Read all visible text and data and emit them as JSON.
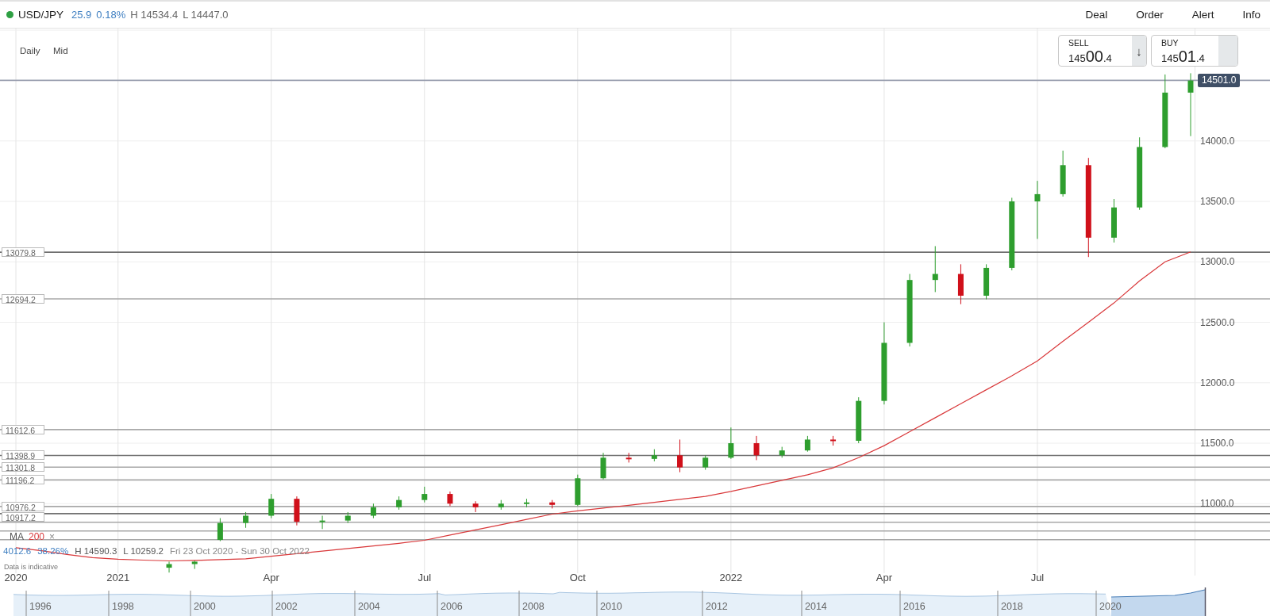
{
  "header": {
    "symbol": "USD/JPY",
    "change": "25.9",
    "change_percent": "0.18%",
    "high": "H 14534.4",
    "low": "L 14447.0",
    "menu": [
      {
        "label": "Deal"
      },
      {
        "label": "Order"
      },
      {
        "label": "Alert"
      },
      {
        "label": "Info"
      }
    ]
  },
  "chart": {
    "interval": "Daily",
    "price_type": "Mid",
    "current_price": "14501.0",
    "sell": {
      "label": "SELL",
      "price_prefix": "145",
      "price_main": "00",
      "price_suffix": ".4",
      "arrow": "↓"
    },
    "buy": {
      "label": "BUY",
      "price_prefix": "145",
      "price_main": "01",
      "price_suffix": ".4"
    },
    "indicator": {
      "period": "200",
      "close": "×"
    },
    "stats": {
      "change": "4012.6",
      "change_percent": "38.26%",
      "high": "H 14590.3",
      "low": "L 10259.2",
      "range": "Fri 23 Oct 2020 - Sun 30 Oct 2022"
    },
    "disclaimer": "Data is indicative",
    "chart_data": {
      "type": "candlestick",
      "categories": [
        "2020",
        null,
        null,
        null,
        "2021",
        null,
        null,
        null,
        null,
        null,
        "Apr",
        null,
        null,
        null,
        null,
        null,
        "Jul",
        null,
        null,
        null,
        null,
        null,
        "Oct",
        null,
        null,
        null,
        null,
        null,
        "2022",
        null,
        null,
        null,
        null,
        null,
        "Apr",
        null,
        null,
        null,
        null,
        null,
        "Jul",
        null,
        null,
        null,
        null,
        null,
        null
      ],
      "ohlc": [
        null,
        null,
        null,
        null,
        null,
        null,
        [
          10470,
          10520,
          10430,
          10500
        ],
        [
          10500,
          10530,
          10460,
          10520
        ],
        [
          10700,
          10880,
          10690,
          10840
        ],
        [
          10840,
          10930,
          10800,
          10900
        ],
        [
          10900,
          11080,
          10880,
          11040
        ],
        [
          11040,
          11060,
          10820,
          10850
        ],
        [
          10850,
          10900,
          10790,
          10860
        ],
        [
          10860,
          10930,
          10840,
          10900
        ],
        [
          10900,
          11000,
          10880,
          10970
        ],
        [
          10970,
          11060,
          10950,
          11030
        ],
        [
          11030,
          11140,
          11010,
          11080
        ],
        [
          11080,
          11100,
          10980,
          11000
        ],
        [
          11000,
          11020,
          10930,
          10970
        ],
        [
          10970,
          11030,
          10950,
          11000
        ],
        [
          11000,
          11040,
          10970,
          11010
        ],
        [
          11010,
          11030,
          10960,
          10990
        ],
        [
          10990,
          11240,
          10980,
          11210
        ],
        [
          11210,
          11420,
          11200,
          11380
        ],
        [
          11380,
          11420,
          11340,
          11370
        ],
        [
          11370,
          11450,
          11350,
          11400
        ],
        [
          11400,
          11530,
          11260,
          11300
        ],
        [
          11300,
          11400,
          11280,
          11380
        ],
        [
          11380,
          11630,
          11370,
          11500
        ],
        [
          11500,
          11560,
          11360,
          11400
        ],
        [
          11400,
          11470,
          11380,
          11440
        ],
        [
          11440,
          11560,
          11430,
          11530
        ],
        [
          11530,
          11560,
          11480,
          11520
        ],
        [
          11520,
          11880,
          11500,
          11850
        ],
        [
          11850,
          12500,
          11820,
          12330
        ],
        [
          12330,
          12900,
          12300,
          12850
        ],
        [
          12850,
          13130,
          12750,
          12900
        ],
        [
          12900,
          12980,
          12650,
          12720
        ],
        [
          12720,
          12980,
          12690,
          12950
        ],
        [
          12950,
          13530,
          12930,
          13500
        ],
        [
          13500,
          13670,
          13190,
          13560
        ],
        [
          13560,
          13920,
          13540,
          13800
        ],
        [
          13800,
          13860,
          13040,
          13200
        ],
        [
          13200,
          13520,
          13160,
          13450
        ],
        [
          13450,
          14030,
          13430,
          13950
        ],
        [
          13950,
          14550,
          13940,
          14400
        ],
        [
          14400,
          14560,
          14040,
          14500
        ]
      ],
      "series": [
        {
          "name": "MA",
          "type": "line",
          "color": "#d9393b",
          "values": [
            10635,
            10610,
            10580,
            10553,
            10540,
            10533,
            10526,
            10530,
            10537,
            10544,
            10565,
            10586,
            10607,
            10629,
            10650,
            10672,
            10697,
            10740,
            10783,
            10826,
            10869,
            10913,
            10940,
            10963,
            10987,
            11011,
            11036,
            11060,
            11101,
            11147,
            11193,
            11239,
            11296,
            11380,
            11480,
            11595,
            11711,
            11826,
            11942,
            12057,
            12181,
            12343,
            12500,
            12660,
            12843,
            13000,
            13082
          ]
        }
      ],
      "grid": true,
      "ylim": [
        10405,
        14930
      ],
      "yticks": [
        {
          "value": 11000,
          "label": "11000.0"
        },
        {
          "value": 11500,
          "label": "11500.0"
        },
        {
          "value": 12000,
          "label": "12000.0"
        },
        {
          "value": 12500,
          "label": "12500.0"
        },
        {
          "value": 13000,
          "label": "13000.0"
        },
        {
          "value": 13500,
          "label": "13500.0"
        },
        {
          "value": 14000,
          "label": "14000.0"
        }
      ],
      "ref_lines": [
        {
          "axis": "y",
          "value": 14501.0,
          "color": "#9a9fb0"
        },
        {
          "axis": "y",
          "value": 13079.8,
          "label": "13079.8",
          "color": "#707070"
        },
        {
          "axis": "y",
          "value": 12694.2,
          "label": "12694.2",
          "color": "#a8a8a8"
        },
        {
          "axis": "y",
          "value": 11612.6,
          "label": "11612.6",
          "color": "#a8a8a8"
        },
        {
          "axis": "y",
          "value": 11398.9,
          "label": "11398.9",
          "color": "#707070"
        },
        {
          "axis": "y",
          "value": 11301.8,
          "label": "11301.8",
          "color": "#a8a8a8"
        },
        {
          "axis": "y",
          "value": 11196.2,
          "label": "11196.2",
          "color": "#a8a8a8"
        },
        {
          "axis": "y",
          "value": 10976.2,
          "label": "10976.2",
          "color": "#a8a8a8"
        },
        {
          "axis": "y",
          "value": 10917.2,
          "label": "10917.2",
          "color": "#707070"
        },
        {
          "axis": "y",
          "value": 10846,
          "color": "#a8a8a8"
        },
        {
          "axis": "y",
          "value": 10774,
          "color": "#a8a8a8"
        },
        {
          "axis": "y",
          "value": 10702,
          "color": "#a8a8a8"
        }
      ]
    }
  },
  "navigator": {
    "years": [
      "1996",
      "1998",
      "2000",
      "2002",
      "2004",
      "2006",
      "2008",
      "2010",
      "2012",
      "2014",
      "2016",
      "2018",
      "2020"
    ]
  }
}
